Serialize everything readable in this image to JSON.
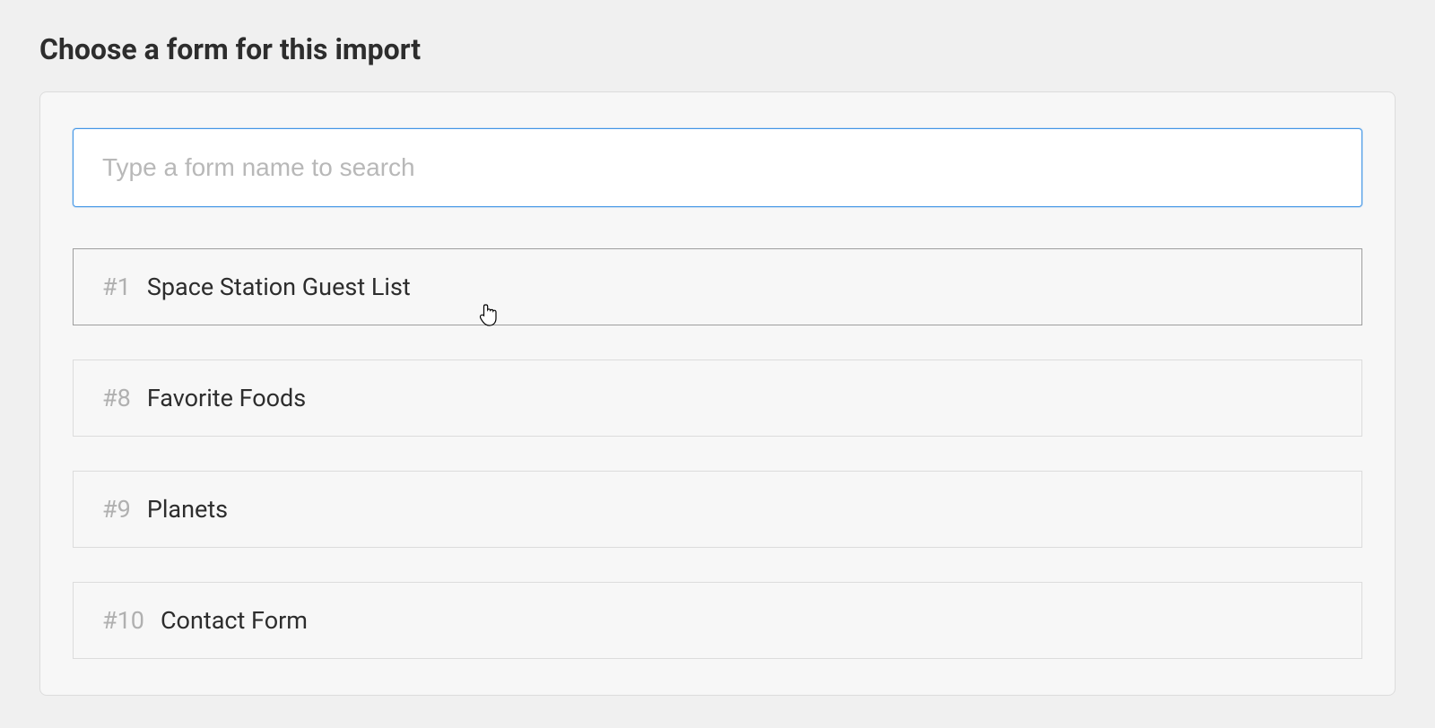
{
  "title": "Choose a form for this import",
  "search": {
    "placeholder": "Type a form name to search",
    "value": ""
  },
  "forms": [
    {
      "id": "#1",
      "name": "Space Station Guest List",
      "hovered": true
    },
    {
      "id": "#8",
      "name": "Favorite Foods",
      "hovered": false
    },
    {
      "id": "#9",
      "name": "Planets",
      "hovered": false
    },
    {
      "id": "#10",
      "name": "Contact Form",
      "hovered": false
    }
  ]
}
